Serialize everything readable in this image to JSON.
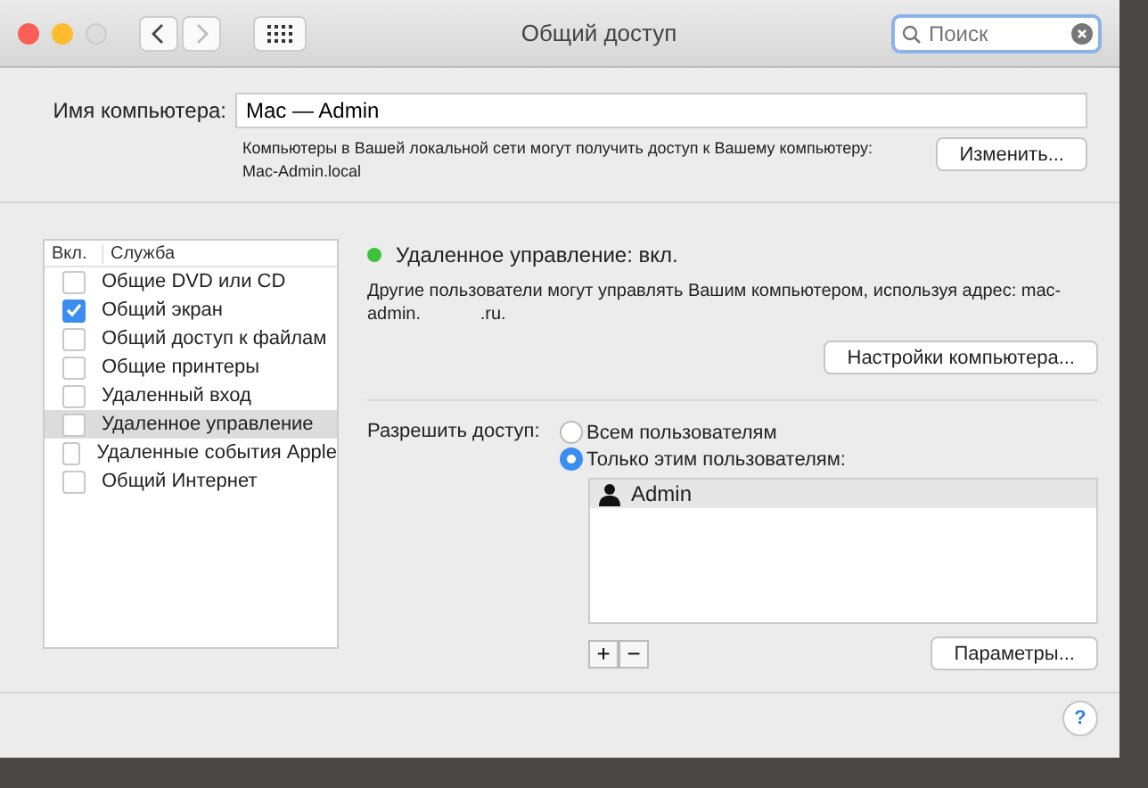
{
  "window": {
    "title": "Общий доступ"
  },
  "search": {
    "placeholder": "Поиск"
  },
  "computer_name": {
    "label": "Имя компьютера:",
    "value": "Mac — Admin",
    "note": "Компьютеры в Вашей локальной сети могут получить доступ к Вашему компьютеру:",
    "host": "Mac-Admin.local",
    "button": "Изменить..."
  },
  "services": {
    "columns": [
      "Вкл.",
      "Служба"
    ],
    "rows": [
      {
        "name": "Общие DVD или CD",
        "checked": false,
        "selected": false
      },
      {
        "name": "Общий экран",
        "checked": true,
        "selected": false
      },
      {
        "name": "Общий доступ к файлам",
        "checked": false,
        "selected": false
      },
      {
        "name": "Общие принтеры",
        "checked": false,
        "selected": false
      },
      {
        "name": "Удаленный вход",
        "checked": false,
        "selected": false
      },
      {
        "name": "Удаленное управление",
        "checked": false,
        "selected": true
      },
      {
        "name": "Удаленные события Apple",
        "checked": false,
        "selected": false
      },
      {
        "name": "Общий Интернет",
        "checked": false,
        "selected": false
      }
    ]
  },
  "detail": {
    "status": "Удаленное управление: вкл.",
    "status_on": true,
    "description": "Другие пользователи могут управлять Вашим компьютером, используя адрес: mac-admin.            .ru.",
    "settings_button": "Настройки компьютера...",
    "access_label": "Разрешить доступ:",
    "access_options": [
      {
        "label": "Всем пользователям",
        "selected": false
      },
      {
        "label": "Только этим пользователям:",
        "selected": true
      }
    ],
    "users": [
      "Admin"
    ],
    "add_button": "+",
    "remove_button": "−",
    "options_button": "Параметры..."
  },
  "help_button": "?"
}
